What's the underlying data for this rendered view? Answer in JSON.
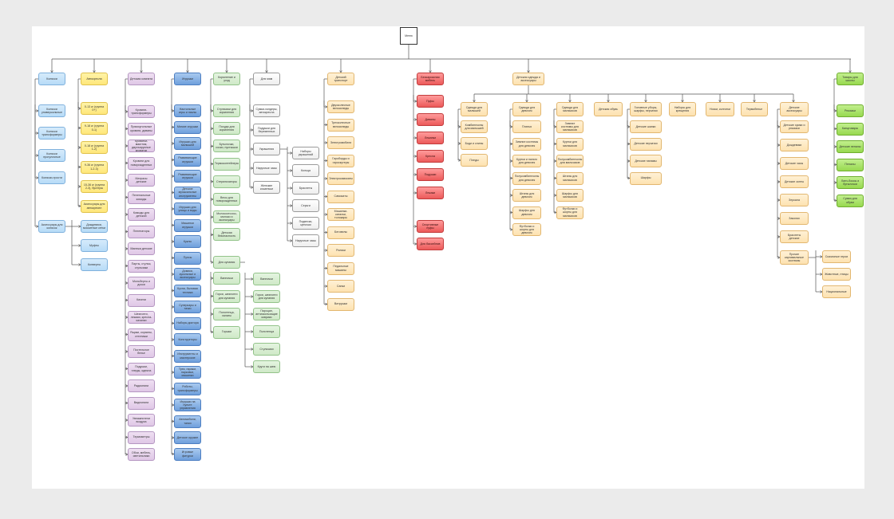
{
  "colors": {
    "blue": "#b7dbf7",
    "yellow": "#ffe77a",
    "purple": "#dfc7e6",
    "dark_blue": "#6f9fdc",
    "green": "#cfe9c7",
    "white": "#eeeeee",
    "orange": "#fde2b0",
    "red": "#ec5a5a",
    "light_green": "#97d94f",
    "background": "#ebebeb",
    "connector": "#333333"
  },
  "root": {
    "label": "Меню"
  },
  "columns": [
    {
      "id": "strollers",
      "color": "blue",
      "label": "Коляски",
      "children": [
        "Коляски универсальные",
        "Коляски трансформеры",
        "Коляски прогулочные",
        "Коляски-трости"
      ],
      "subgroup": {
        "label": "Аксессуары для колясок",
        "children": [
          "Дождевики, москитные сетки",
          "Муфты",
          "Конверты"
        ]
      }
    },
    {
      "id": "car_seats",
      "color": "yellow",
      "label": "Автокресла",
      "children": [
        "0-13 кг (группа 0+)",
        "9-18 кг (группа 0-1)",
        "0-18 кг (группа 1-2)",
        "9-36 кг (группа 1-2-3)",
        "15-36 кг (группа 2-3), бустеры",
        "Аксессуары для автокресел"
      ]
    },
    {
      "id": "nursery",
      "color": "purple",
      "label": "Детская комната",
      "children": [
        "Кровати-трансформеры",
        "Прямоугольные кровати, диваны",
        "Кроватки-маятник, двухъярусные кроватки",
        "Кровати для новорожденных",
        "Матрасы детские",
        "Пеленальные комоды",
        "Комоды для детской",
        "Пеленаторы",
        "Манежи детские",
        "Парты, стулья, стульчики",
        "Мольберты и доски",
        "Качели",
        "Шезлонги, лежаки, кресла-качалки",
        "Ящики, корзины, стеллажи",
        "Постельное белье",
        "Подушки, пледы, одеяла",
        "Радионяни",
        "Видеоняни",
        "Увлажнители воздуха",
        "Термометры",
        "Обои, мебель, светильники"
      ]
    },
    {
      "id": "toys",
      "color": "dark_blue",
      "label": "Игрушки",
      "children": [
        "Настольные игры и пазлы",
        "Мягкие игрушки",
        "Игрушки для малышей",
        "Развивающие игрушки",
        "Развивающие игрушки",
        "Детские музыкальные инструменты",
        "Игрушки для улицы и воды",
        "Машинки игрушки",
        "Куклы",
        "Пупсы",
        "Домики, кукольные и аксессуары",
        "Кухни, бытовая техника",
        "Суперкары и тачки",
        "Наборы доктора",
        "Конструкторы",
        "Инструменты и мастерские",
        "Трек, гаражи, парковки, машинки",
        "Роботы, трансформеры",
        "Игрушки на пульте управления",
        "Автомобили, танки",
        "Детское оружие",
        "Игровые фигурки"
      ]
    },
    {
      "id": "care",
      "color": "green",
      "label": "Кормление и уход",
      "children": [
        "Стульчики для кормления",
        "Посуда для кормления",
        "Бутылочки, соски, пустышки",
        "Термоконтейнеры",
        "Стерилизаторы",
        "Весы для новорожденных",
        "Молокоотсосы, молоко и аксессуары",
        "Детская безопасность"
      ],
      "subgroup": {
        "label": "Для купания",
        "children": [
          "Ванночки",
          "Горки, шезлонги для купания",
          "Полотенца, халаты",
          "Горшки"
        ],
        "sub_children": [
          "Ванночки",
          "Горки, шезлонги для купания",
          "Пароцап, антискользящие коврики",
          "Полотенца",
          "Стульчики",
          "Круги на шею"
        ]
      }
    },
    {
      "id": "moms",
      "color": "white",
      "label": "Для мам",
      "children": [
        "Сумки-холдеры, автокресла",
        "Подушки для беременных",
        "Украшения",
        "Наручные часы",
        "Женские кошельки"
      ],
      "subgroup_children": [
        "Наборы украшений",
        "Кольца",
        "Браслеты",
        "Серьги",
        "Подвески, цепочки",
        "Наручные часы"
      ]
    },
    {
      "id": "transport",
      "color": "orange",
      "label": "Детский транспорт",
      "children": [
        "Двухколесные велосипеды",
        "Трехколесные велосипеды",
        "Электромобили",
        "Гироборды и гироскутеры",
        "Электросамокаты",
        "Самокаты",
        "Машинки-каталки, толокары",
        "Беговелы",
        "Ролики",
        "Педальные машины",
        "Санки",
        "Ватрушки"
      ]
    },
    {
      "id": "furniture",
      "color": "red",
      "label": "Бескаркасная мебель",
      "children": [
        "Пуфы",
        "Диваны",
        "Лежанки",
        "Кресла",
        "Подушки",
        "Лежаки",
        "Спортивные пуфы",
        "Для бассейнов"
      ]
    },
    {
      "id": "clothing",
      "color": "orange",
      "label": "Детская одежда и аксессуары",
      "groups": [
        {
          "label": "Одежда для малышей",
          "children": [
            "Комбинезоны для малышей",
            "Боди и слипы",
            "Пледы"
          ]
        },
        {
          "label": "Одежда для девочек",
          "children": [
            "Платья",
            "Зимние костюмы для девочек",
            "Куртки и пальто для девочек",
            "Полукомбинезоны для девочек",
            "Штаны для девочек",
            "Шарфы для девочек",
            "Футболки и шорты для девочек"
          ]
        },
        {
          "label": "Одежда для мальчиков",
          "children": [
            "Зимние костюмы для мальчиков",
            "Куртки для мальчиков",
            "Полукомбинезоны для мальчиков",
            "Штаны для мальчиков",
            "Шарфы для мальчиков",
            "Футболки и шорты для мальчиков"
          ]
        },
        {
          "label": "Детская обувь",
          "children": []
        },
        {
          "label": "Головные уборы, шарфы, перчатки",
          "children": [
            "Детские шапки",
            "Детские перчатки",
            "Детские панамы",
            "Шарфы"
          ]
        },
        {
          "label": "Наборы для крещения",
          "children": []
        },
        {
          "label": "Носки, колготки",
          "children": []
        },
        {
          "label": "Термобелье",
          "children": []
        }
      ]
    },
    {
      "id": "accessories",
      "color": "orange",
      "label": "Детские аксессуары",
      "children": [
        "Детские сумки и рюкзаки",
        "Дождевики",
        "Детские часы",
        "Детские зонты",
        "Зеркала",
        "Заколки",
        "Браслеты детские"
      ],
      "subgroup": {
        "label": "Прочие карнавальные костюмы",
        "children": [
          "Сказочные герои",
          "Животные, птицы",
          "Национальные"
        ]
      }
    },
    {
      "id": "school",
      "color": "light_green",
      "label": "Товары для школы",
      "children": [
        "Рюкзаки",
        "Канцтовары",
        "Детские пеналы",
        "Пеналы",
        "Ланч-боксы и бутылочки",
        "Сумки для обуви"
      ]
    }
  ]
}
